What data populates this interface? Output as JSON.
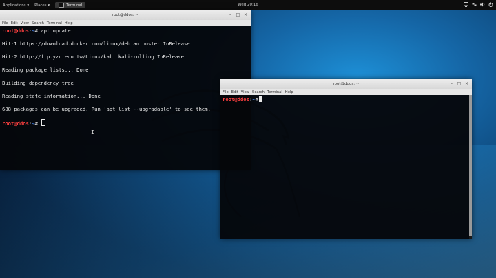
{
  "topbar": {
    "applications": "Applications ▾",
    "places": "Places ▾",
    "task": "Terminal",
    "clock": "Wed 20:16",
    "icons": [
      "screen-icon",
      "network-icon",
      "volume-icon",
      "power-icon"
    ]
  },
  "terminal1": {
    "title": "root@ddos: ~",
    "menu": [
      "File",
      "Edit",
      "View",
      "Search",
      "Terminal",
      "Help"
    ],
    "lines": [
      {
        "user": "root@ddos",
        "path": "~",
        "symbol": "# ",
        "cmd": "apt update"
      },
      {
        "text": "Hit:1 https://download.docker.com/linux/debian buster InRelease"
      },
      {
        "text": "Hit:2 http://ftp.yzu.edu.tw/Linux/kali kali-rolling InRelease"
      },
      {
        "text": "Reading package lists... Done"
      },
      {
        "text": "Building dependency tree"
      },
      {
        "text": "Reading state information... Done"
      },
      {
        "text": "688 packages can be upgraded. Run 'apt list --upgradable' to see them."
      },
      {
        "user": "root@ddos",
        "path": "~",
        "symbol": "# ",
        "cmd": ""
      }
    ],
    "sep": ":"
  },
  "terminal2": {
    "title": "root@ddos: ~",
    "menu": [
      "File",
      "Edit",
      "View",
      "Search",
      "Terminal",
      "Help"
    ],
    "prompt": {
      "user": "root@ddos",
      "path": "~",
      "symbol": "#"
    },
    "sep": ":"
  },
  "colors": {
    "prompt_user": "#ff4040",
    "prompt_path": "#4a8dff"
  }
}
